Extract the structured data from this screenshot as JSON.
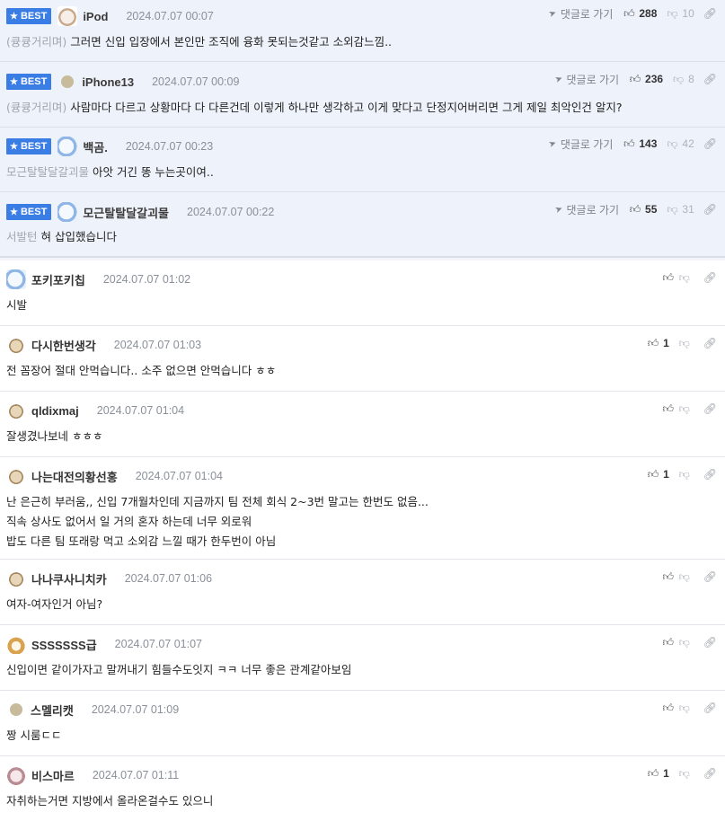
{
  "best_label": "BEST",
  "goto_label": "댓글로 가기",
  "best": [
    {
      "nick": "iPod",
      "date": "2024.07.07 00:07",
      "ref": "(큥큥거리며)",
      "text": "그러면 신입 입장에서 본인만 조직에 융화 못되는것같고 소외감느낌..",
      "up": "288",
      "down": "10"
    },
    {
      "nick": "iPhone13",
      "date": "2024.07.07 00:09",
      "ref": "(큥큥거리며)",
      "text": "사람마다 다르고 상황마다 다 다른건데 이렇게 하나만 생각하고 이게 맞다고 단정지어버리면 그게 제일 최악인건 알지?",
      "up": "236",
      "down": "8"
    },
    {
      "nick": "백곰.",
      "date": "2024.07.07 00:23",
      "ref": "모근탈탈달갈괴물",
      "text": "아앗 거긴 똥 누는곳이여..",
      "up": "143",
      "down": "42"
    },
    {
      "nick": "모근탈탈달갈괴물",
      "date": "2024.07.07 00:22",
      "ref": "서발턴",
      "text": "혀 삽입했습니다",
      "up": "55",
      "down": "31"
    }
  ],
  "comments": [
    {
      "nick": "포키포키칩",
      "date": "2024.07.07 01:02",
      "lines": [
        "시발"
      ],
      "up": ""
    },
    {
      "nick": "다시한번생각",
      "date": "2024.07.07 01:03",
      "lines": [
        "전 꼼장어 절대 안먹습니다.. 소주 없으면 안먹습니다 ㅎㅎ"
      ],
      "up": "1"
    },
    {
      "nick": "qldixmaj",
      "date": "2024.07.07 01:04",
      "lines": [
        "잘생겼나보네 ㅎㅎㅎ"
      ],
      "up": ""
    },
    {
      "nick": "나는대전의황선홍",
      "date": "2024.07.07 01:04",
      "lines": [
        "난 은근히 부러움,, 신입 7개월차인데 지금까지 팀 전체 회식 2~3번 말고는 한번도 없음...",
        "직속 상사도 없어서 일 거의 혼자 하는데 너무 외로워",
        "밥도 다른 팀 또래랑 먹고 소외감 느낄 때가 한두번이 아님"
      ],
      "up": "1"
    },
    {
      "nick": "나나쿠사니치카",
      "date": "2024.07.07 01:06",
      "lines": [
        "여자-여자인거 아님?"
      ],
      "up": ""
    },
    {
      "nick": "SSSSSSS급",
      "date": "2024.07.07 01:07",
      "lines": [
        "신입이면 같이가자고 말꺼내기 힘들수도잇지 ㅋㅋ 너무 좋은 관계같아보임"
      ],
      "up": ""
    },
    {
      "nick": "스멜리캣",
      "date": "2024.07.07 01:09",
      "lines": [
        "짱 시룸ㄷㄷ"
      ],
      "up": ""
    },
    {
      "nick": "비스마르",
      "date": "2024.07.07 01:11",
      "lines": [
        "자취하는거면 지방에서 올라온걸수도 있으니"
      ],
      "up": "1"
    }
  ]
}
